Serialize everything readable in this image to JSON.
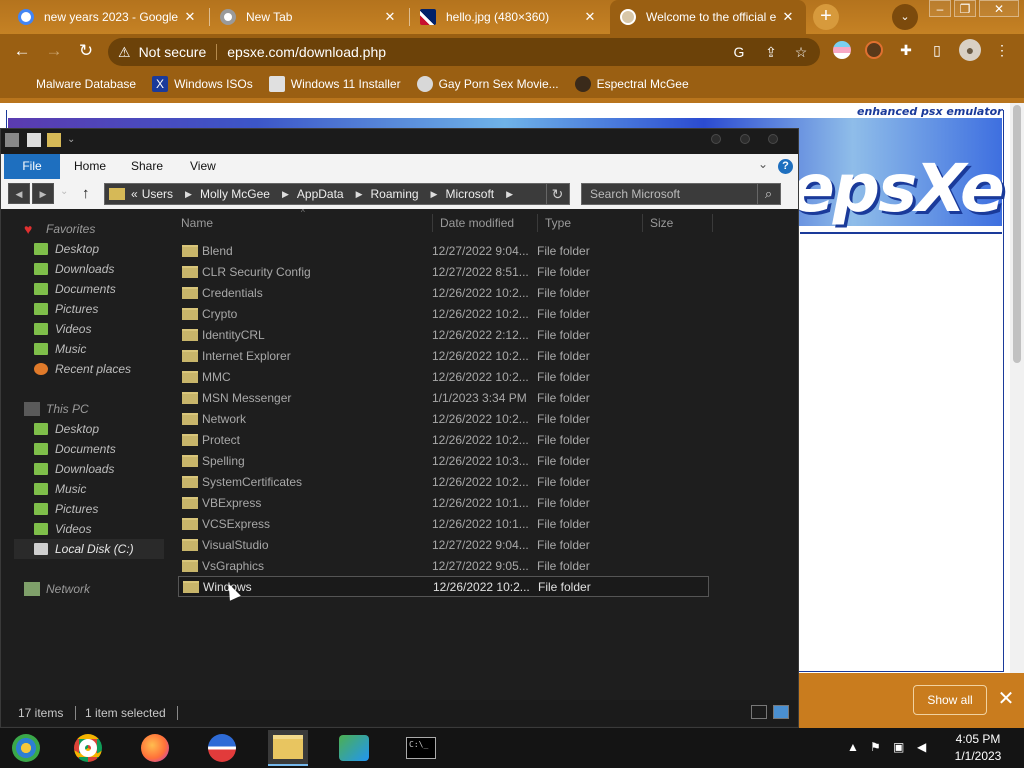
{
  "browser": {
    "tabs": [
      {
        "title": "new years 2023 - Google",
        "icon": "google-icon"
      },
      {
        "title": "New Tab",
        "icon": "chrome-icon"
      },
      {
        "title": "hello.jpg (480×360)",
        "icon": "image-icon"
      },
      {
        "title": "Welcome to the official e",
        "icon": "globe-icon"
      }
    ],
    "new_tab_label": "+",
    "security_label": "Not secure",
    "url": "epsxe.com/download.php",
    "bookmarks": [
      {
        "label": "Malware Database"
      },
      {
        "label": "Windows ISOs"
      },
      {
        "label": "Windows 11 Installer"
      },
      {
        "label": "Gay Porn Sex Movie..."
      },
      {
        "label": "Espectral McGee"
      }
    ]
  },
  "webpage": {
    "tagline": "enhanced psx emulator",
    "logo": "epsXe"
  },
  "download_bar": {
    "show_all_label": "Show all",
    "close_label": "✕"
  },
  "explorer": {
    "ribbon_tabs": [
      "File",
      "Home",
      "Share",
      "View"
    ],
    "breadcrumb": [
      "Users",
      "Molly McGee",
      "AppData",
      "Roaming",
      "Microsoft"
    ],
    "breadcrumb_prefix": "«",
    "search_placeholder": "Search Microsoft",
    "columns": {
      "name": "Name",
      "date": "Date modified",
      "type": "Type",
      "size": "Size"
    },
    "nav": {
      "favorites_label": "Favorites",
      "favorites": [
        "Desktop",
        "Downloads",
        "Documents",
        "Pictures",
        "Videos",
        "Music",
        "Recent places"
      ],
      "thispc_label": "This PC",
      "thispc": [
        "Desktop",
        "Documents",
        "Downloads",
        "Music",
        "Pictures",
        "Videos",
        "Local Disk (C:)"
      ],
      "network_label": "Network"
    },
    "files": [
      {
        "name": "Blend",
        "date": "12/27/2022 9:04...",
        "type": "File folder"
      },
      {
        "name": "CLR Security Config",
        "date": "12/27/2022 8:51...",
        "type": "File folder"
      },
      {
        "name": "Credentials",
        "date": "12/26/2022 10:2...",
        "type": "File folder"
      },
      {
        "name": "Crypto",
        "date": "12/26/2022 10:2...",
        "type": "File folder"
      },
      {
        "name": "IdentityCRL",
        "date": "12/26/2022 2:12...",
        "type": "File folder"
      },
      {
        "name": "Internet Explorer",
        "date": "12/26/2022 10:2...",
        "type": "File folder"
      },
      {
        "name": "MMC",
        "date": "12/26/2022 10:2...",
        "type": "File folder"
      },
      {
        "name": "MSN Messenger",
        "date": "1/1/2023 3:34 PM",
        "type": "File folder"
      },
      {
        "name": "Network",
        "date": "12/26/2022 10:2...",
        "type": "File folder"
      },
      {
        "name": "Protect",
        "date": "12/26/2022 10:2...",
        "type": "File folder"
      },
      {
        "name": "Spelling",
        "date": "12/26/2022 10:3...",
        "type": "File folder"
      },
      {
        "name": "SystemCertificates",
        "date": "12/26/2022 10:2...",
        "type": "File folder"
      },
      {
        "name": "VBExpress",
        "date": "12/26/2022 10:1...",
        "type": "File folder"
      },
      {
        "name": "VCSExpress",
        "date": "12/26/2022 10:1...",
        "type": "File folder"
      },
      {
        "name": "VisualStudio",
        "date": "12/27/2022 9:04...",
        "type": "File folder"
      },
      {
        "name": "VsGraphics",
        "date": "12/27/2022 9:05...",
        "type": "File folder"
      },
      {
        "name": "Windows",
        "date": "12/26/2022 10:2...",
        "type": "File folder"
      }
    ],
    "status": {
      "items": "17 items",
      "selected": "1 item selected"
    }
  },
  "taskbar": {
    "time": "4:05 PM",
    "date": "1/1/2023",
    "cmd_label": "C:\\_"
  },
  "colors": {
    "chrome_theme": "#b4731d",
    "explorer_bg": "#1e1e1e",
    "ribbon_file": "#1e6fbf",
    "folder": "#c8b56a",
    "taskbar": "#141414"
  }
}
